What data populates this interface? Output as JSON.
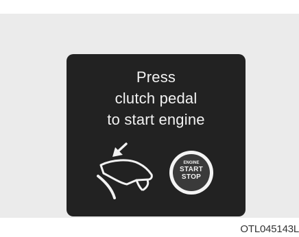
{
  "message": {
    "line1": "Press",
    "line2": "clutch pedal",
    "line3": "to start engine"
  },
  "start_button": {
    "line1": "ENGINE",
    "line2": "START",
    "line3": "STOP"
  },
  "figure_code": "OTL045143L",
  "icons": {
    "pedal": "clutch-pedal-icon",
    "button": "engine-start-stop-button-icon"
  },
  "colors": {
    "background": "#ebebeb",
    "screen": "#222222",
    "text": "#f2f2f2",
    "button_ring": "#f4f4f4",
    "button_face": "#3a3a3a"
  }
}
